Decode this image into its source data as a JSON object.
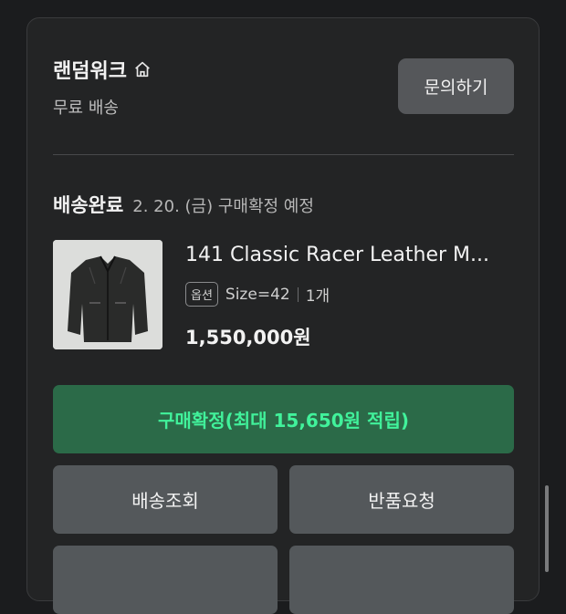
{
  "store": {
    "name": "랜덤워크",
    "shipping": "무료 배송",
    "inquiry_label": "문의하기"
  },
  "order": {
    "status": "배송완료",
    "status_detail": "2. 20. (금) 구매확정 예정"
  },
  "product": {
    "name": "141 Classic Racer Leather M...",
    "option_badge": "옵션",
    "size": "Size=42",
    "quantity": "1개",
    "price": "1,550,000원"
  },
  "actions": {
    "confirm_label": "구매확정(최대 15,650원 적립)",
    "track_label": "배송조회",
    "return_label": "반품요청"
  },
  "colors": {
    "confirm_bg": "#2b6a48",
    "confirm_text": "#41f29b"
  }
}
